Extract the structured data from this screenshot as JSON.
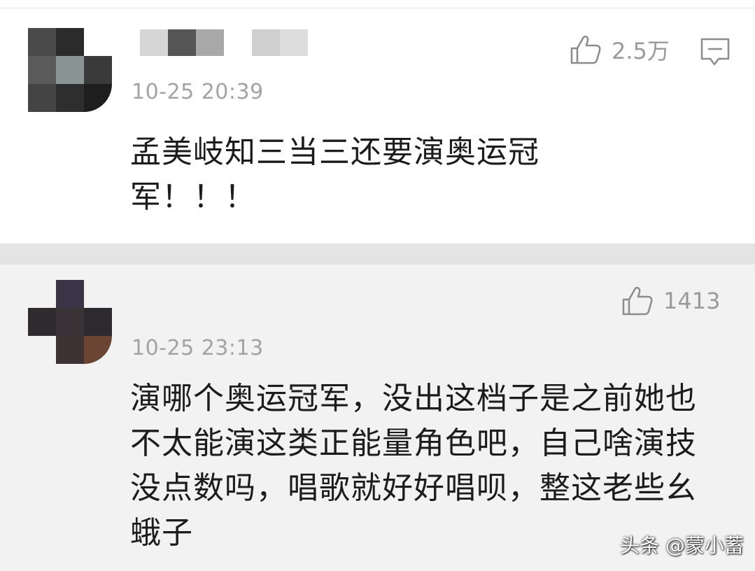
{
  "comments": [
    {
      "timestamp": "10-25 20:39",
      "likes": "2.5万",
      "text_line1": "孟美岐知三当三还要演奥运冠",
      "text_line2": "军！！！",
      "icons": [
        "thumbs-up-icon",
        "reply-icon"
      ]
    },
    {
      "timestamp": "10-25 23:13",
      "likes": "1413",
      "text_line1": "演哪个奥运冠军，没出这档子是之前她也",
      "text_line2": "不太能演这类正能量角色吧，自己啥演技",
      "text_line3": "没点数吗，唱歌就好好唱呗，整这老些幺",
      "text_line4": "蛾子",
      "icons": [
        "thumbs-up-icon"
      ]
    }
  ],
  "watermark": "头条 @蒙小蓄"
}
